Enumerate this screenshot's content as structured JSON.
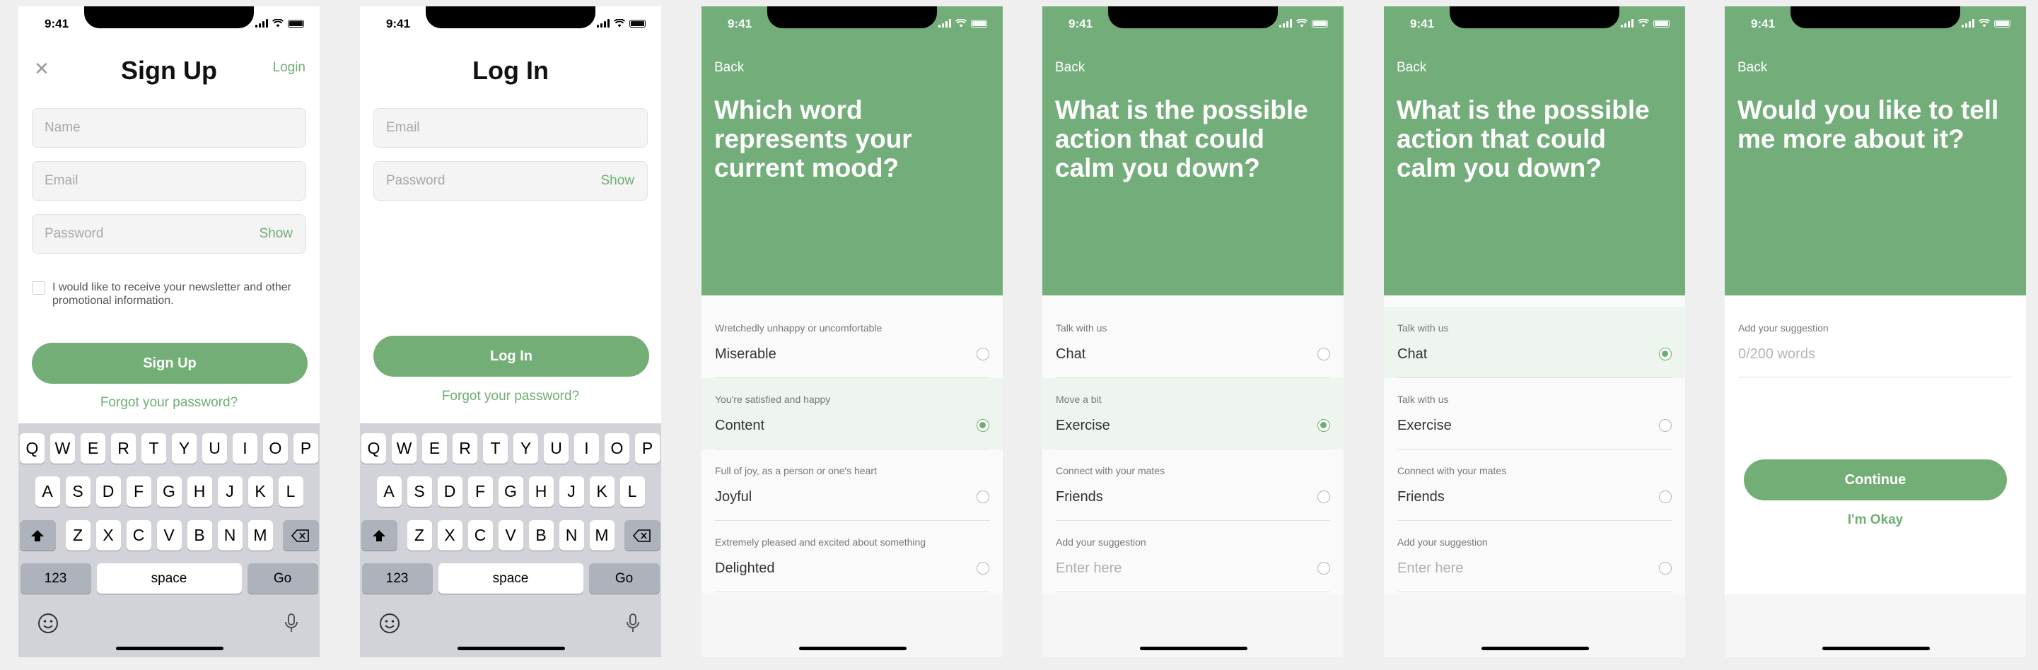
{
  "status_time": "9:41",
  "signup": {
    "title": "Sign Up",
    "login_link": "Login",
    "name_placeholder": "Name",
    "email_placeholder": "Email",
    "password_placeholder": "Password",
    "show_label": "Show",
    "newsletter_text": "I would like to receive your newsletter and other promotional information.",
    "signup_button": "Sign Up",
    "forgot_link": "Forgot your password?"
  },
  "login": {
    "title": "Log In",
    "email_placeholder": "Email",
    "password_placeholder": "Password",
    "show_label": "Show",
    "login_button": "Log In",
    "forgot_link": "Forgot your password?"
  },
  "keyboard": {
    "row1": [
      "Q",
      "W",
      "E",
      "R",
      "T",
      "Y",
      "U",
      "I",
      "O",
      "P"
    ],
    "row2": [
      "A",
      "S",
      "D",
      "F",
      "G",
      "H",
      "J",
      "K",
      "L"
    ],
    "row3": [
      "Z",
      "X",
      "C",
      "V",
      "B",
      "N",
      "M"
    ],
    "numbers": "123",
    "space": "space",
    "go": "Go"
  },
  "mood": {
    "back": "Back",
    "question": "Which word represents your current mood?",
    "options": [
      {
        "hint": "Wretchedly unhappy or uncomfortable",
        "label": "Miserable",
        "selected": false
      },
      {
        "hint": "You're satisfied and happy",
        "label": "Content",
        "selected": true
      },
      {
        "hint": "Full of joy, as a person or one's heart",
        "label": "Joyful",
        "selected": false
      },
      {
        "hint": "Extremely pleased and excited about something",
        "label": "Delighted",
        "selected": false
      }
    ]
  },
  "action1": {
    "back": "Back",
    "question": "What is the possible action that could calm you down?",
    "options": [
      {
        "hint": "Talk with us",
        "label": "Chat",
        "selected": false,
        "placeholder": false
      },
      {
        "hint": "Move a bit",
        "label": "Exercise",
        "selected": true,
        "placeholder": false
      },
      {
        "hint": "Connect with your mates",
        "label": "Friends",
        "selected": false,
        "placeholder": false
      },
      {
        "hint": "Add your suggestion",
        "label": "Enter here",
        "selected": false,
        "placeholder": true
      }
    ]
  },
  "action2": {
    "back": "Back",
    "question": "What is the possible action that could calm you down?",
    "options": [
      {
        "hint": "Talk with us",
        "label": "Chat",
        "selected": true,
        "placeholder": false
      },
      {
        "hint": "Talk with us",
        "label": "Exercise",
        "selected": false,
        "placeholder": false
      },
      {
        "hint": "Connect with your mates",
        "label": "Friends",
        "selected": false,
        "placeholder": false
      },
      {
        "hint": "Add your suggestion",
        "label": "Enter here",
        "selected": false,
        "placeholder": true
      }
    ]
  },
  "more": {
    "back": "Back",
    "question": "Would you like to tell me more about it?",
    "suggestion_label": "Add your suggestion",
    "suggestion_placeholder": "0/200 words",
    "continue_button": "Continue",
    "okay_link": "I'm Okay"
  },
  "colors": {
    "accent": "#73ae76",
    "hero": "#73ae7a",
    "keyboard": "#d1d3d9"
  },
  "icons": [
    "close-icon",
    "signal-icon",
    "wifi-icon",
    "battery-icon",
    "shift-icon",
    "backspace-icon",
    "emoji-icon",
    "microphone-icon"
  ]
}
